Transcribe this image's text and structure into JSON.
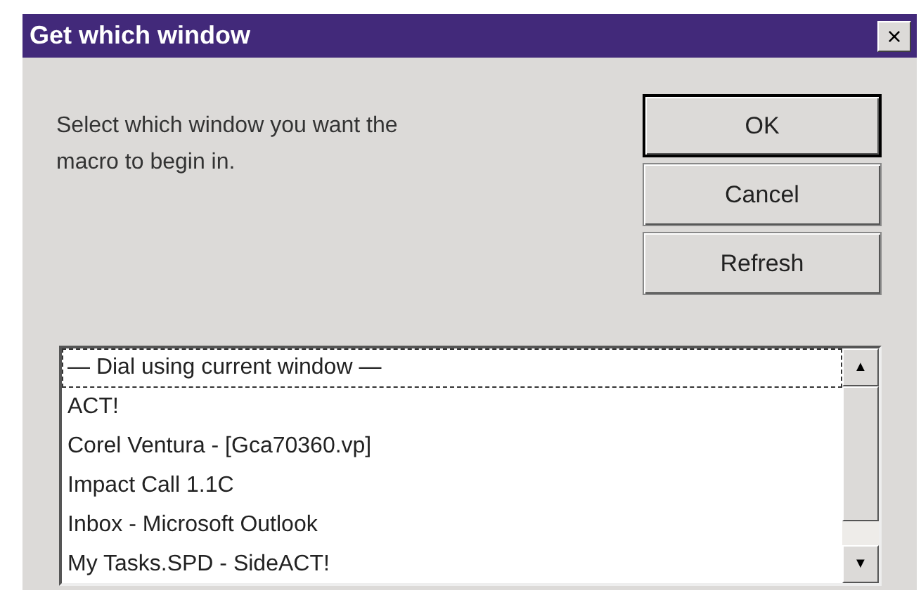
{
  "window": {
    "title": "Get which window",
    "close": "×"
  },
  "prompt": "Select which window you want the macro to begin in.",
  "buttons": [
    {
      "label": "OK",
      "default": true
    },
    {
      "label": "Cancel",
      "default": false
    },
    {
      "label": "Refresh",
      "default": false
    }
  ],
  "list": {
    "items": [
      {
        "label": "— Dial using current window —",
        "focused": true
      },
      {
        "label": "ACT!",
        "focused": false
      },
      {
        "label": "Corel Ventura - [Gca70360.vp]",
        "focused": false
      },
      {
        "label": "Impact Call 1.1C",
        "focused": false
      },
      {
        "label": "Inbox - Microsoft Outlook",
        "focused": false
      },
      {
        "label": "My Tasks.SPD - SideACT!",
        "focused": false
      }
    ],
    "scroll_up": "▲",
    "scroll_down": "▼"
  }
}
